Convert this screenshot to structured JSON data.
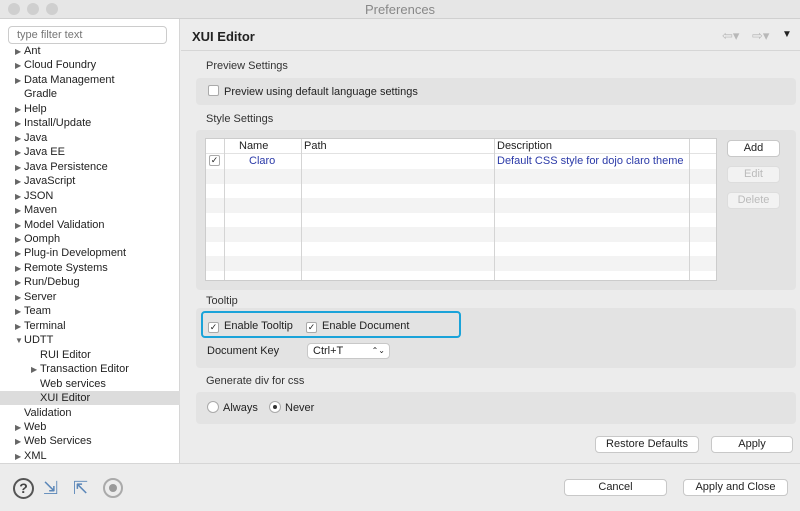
{
  "window": {
    "title": "Preferences"
  },
  "sidebar": {
    "filter_placeholder": "type filter text",
    "items": [
      {
        "label": "Ant",
        "arrow": true
      },
      {
        "label": "Cloud Foundry",
        "arrow": true
      },
      {
        "label": "Data Management",
        "arrow": true
      },
      {
        "label": "Gradle",
        "arrow": false
      },
      {
        "label": "Help",
        "arrow": true
      },
      {
        "label": "Install/Update",
        "arrow": true
      },
      {
        "label": "Java",
        "arrow": true
      },
      {
        "label": "Java EE",
        "arrow": true
      },
      {
        "label": "Java Persistence",
        "arrow": true
      },
      {
        "label": "JavaScript",
        "arrow": true
      },
      {
        "label": "JSON",
        "arrow": true
      },
      {
        "label": "Maven",
        "arrow": true
      },
      {
        "label": "Model Validation",
        "arrow": true
      },
      {
        "label": "Oomph",
        "arrow": true
      },
      {
        "label": "Plug-in Development",
        "arrow": true
      },
      {
        "label": "Remote Systems",
        "arrow": true
      },
      {
        "label": "Run/Debug",
        "arrow": true
      },
      {
        "label": "Server",
        "arrow": true
      },
      {
        "label": "Team",
        "arrow": true
      },
      {
        "label": "Terminal",
        "arrow": true
      },
      {
        "label": "UDTT",
        "arrow": true,
        "expanded": true
      },
      {
        "label": "RUI Editor",
        "arrow": false,
        "child": true
      },
      {
        "label": "Transaction Editor",
        "arrow": true,
        "child": true
      },
      {
        "label": "Web services",
        "arrow": false,
        "child": true
      },
      {
        "label": "XUI Editor",
        "arrow": false,
        "child": true,
        "selected": true
      },
      {
        "label": "Validation",
        "arrow": false
      },
      {
        "label": "Web",
        "arrow": true
      },
      {
        "label": "Web Services",
        "arrow": true
      },
      {
        "label": "XML",
        "arrow": true
      }
    ]
  },
  "page": {
    "title": "XUI Editor"
  },
  "preview": {
    "label": "Preview Settings",
    "checkbox": "Preview using default language settings",
    "checked": false
  },
  "style": {
    "label": "Style Settings",
    "columns": [
      "Name",
      "Path",
      "Description"
    ],
    "rows": [
      {
        "checked": true,
        "name": "Claro",
        "path": "",
        "description": "Default CSS style for dojo claro theme"
      }
    ],
    "add": "Add",
    "edit": "Edit",
    "delete": "Delete"
  },
  "tooltip": {
    "label": "Tooltip",
    "enable_tooltip": "Enable Tooltip",
    "enable_document": "Enable Document",
    "doc_key_label": "Document Key",
    "doc_key_value": "Ctrl+T"
  },
  "gendiv": {
    "label": "Generate div for css",
    "always": "Always",
    "never": "Never",
    "selected": "Never"
  },
  "buttons": {
    "restore": "Restore Defaults",
    "apply": "Apply",
    "cancel": "Cancel",
    "apply_close": "Apply and Close"
  },
  "colors": {
    "highlight": "#1aa3d9",
    "link": "#2b3aa8"
  }
}
